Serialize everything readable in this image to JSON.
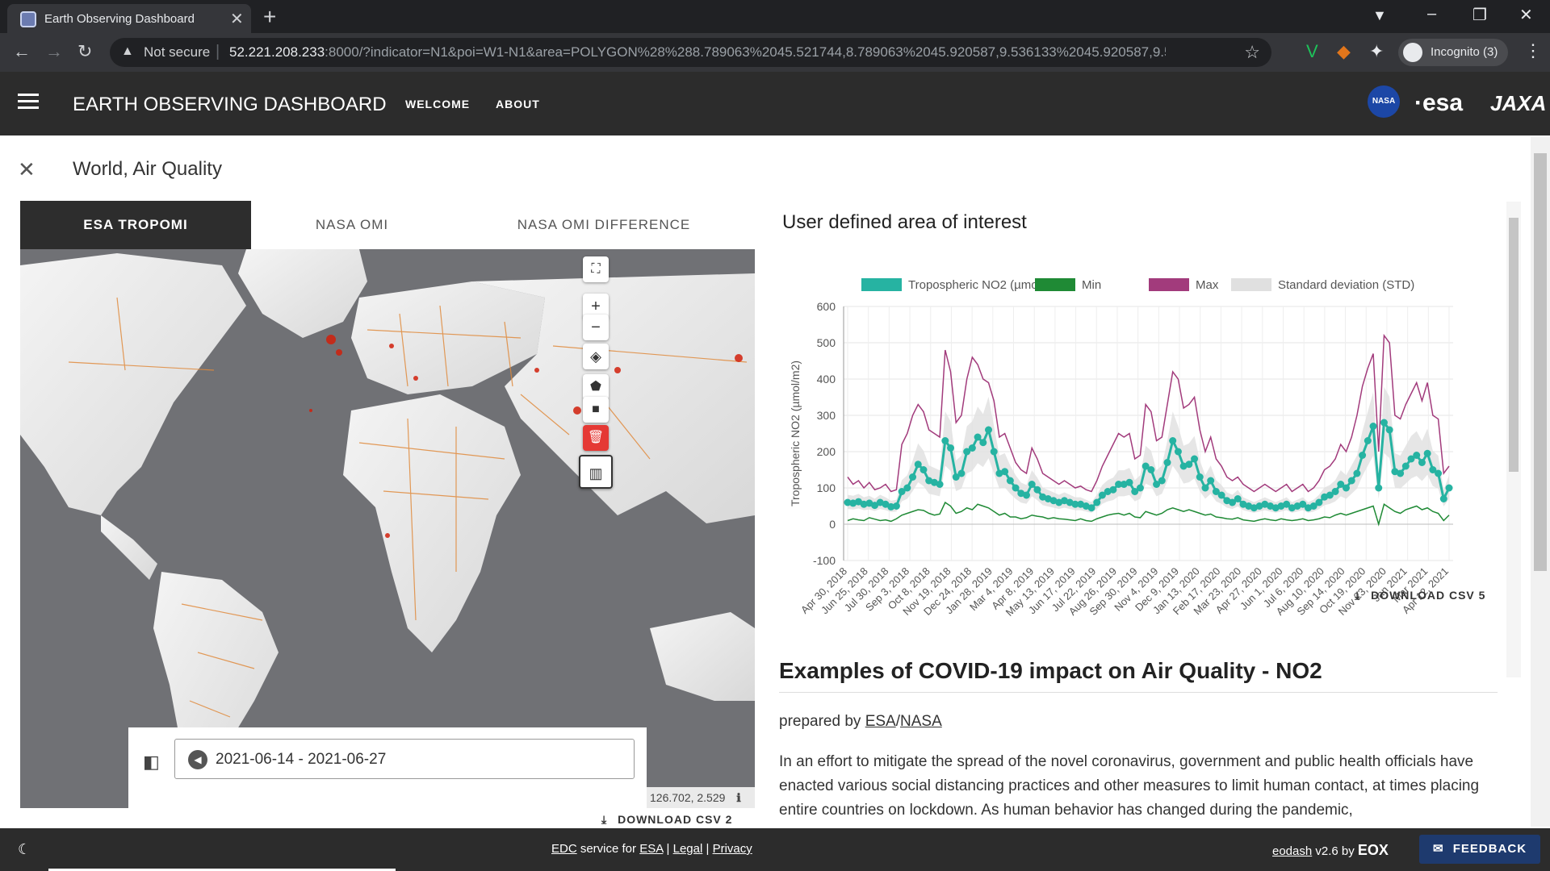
{
  "browser": {
    "tab_title": "Earth Observing Dashboard",
    "not_secure": "Not secure",
    "url_host": "52.221.208.233",
    "url_rest": ":8000/?indicator=N1&poi=W1-N1&area=POLYGON%28%288.789063%2045.521744,8.789063%2045.920587,9.536133%2045.920587,9.536133%204...",
    "incognito": "Incognito (3)"
  },
  "header": {
    "title": "EARTH OBSERVING DASHBOARD",
    "nav": [
      "WELCOME",
      "ABOUT"
    ],
    "logos": {
      "nasa": "NASA",
      "esa": "esa",
      "jaxa": "JAXA"
    }
  },
  "panel": {
    "title": "World, Air Quality",
    "tabs": [
      "ESA TROPOMI",
      "NASA OMI",
      "NASA OMI DIFFERENCE"
    ],
    "active_tab": "ESA TROPOMI"
  },
  "map": {
    "date_range": "2021-06-14 - 2021-06-27",
    "coords": "126.702, 2.529",
    "download": "DOWNLOAD CSV 2",
    "icons": [
      "fullscreen-icon",
      "zoom-in-icon",
      "zoom-out-icon",
      "layers-icon",
      "draw-polygon-icon",
      "draw-rectangle-icon",
      "delete-icon",
      "chart-icon",
      "compare-icon",
      "arrow-left-icon",
      "info-icon",
      "download-icon"
    ]
  },
  "aoi": {
    "title": "User defined area of interest",
    "download": "DOWNLOAD CSV 5"
  },
  "chart_data": {
    "type": "line",
    "ylabel": "Tropospheric NO2 (µmol/m2)",
    "ylim": [
      -100,
      600
    ],
    "yticks": [
      -100,
      0,
      100,
      200,
      300,
      400,
      500,
      600
    ],
    "xticks": [
      "Apr 30, 2018",
      "Jun 25, 2018",
      "Jul 30, 2018",
      "Sep 3, 2018",
      "Oct 8, 2018",
      "Nov 19, 2018",
      "Dec 24, 2018",
      "Jan 28, 2019",
      "Mar 4, 2019",
      "Apr 8, 2019",
      "May 13, 2019",
      "Jun 17, 2019",
      "Jul 22, 2019",
      "Aug 26, 2019",
      "Sep 30, 2019",
      "Nov 4, 2019",
      "Dec 9, 2019",
      "Jan 13, 2020",
      "Feb 17, 2020",
      "Mar 23, 2020",
      "Apr 27, 2020",
      "Jun 1, 2020",
      "Jul 6, 2020",
      "Aug 10, 2020",
      "Sep 14, 2020",
      "Oct 19, 2020",
      "Nov 23, 2020",
      "Jan 2021",
      "Mar 2021",
      "Apr 12, 2021"
    ],
    "legend_placement": "top",
    "grid": true,
    "legend": [
      {
        "name": "Tropospheric NO2 (µmol/m2)",
        "color": "#26b3a2"
      },
      {
        "name": "Min",
        "color": "#1f8a35"
      },
      {
        "name": "Max",
        "color": "#a23b7c"
      },
      {
        "name": "Standard deviation (STD)",
        "color": "#e0e0e0"
      }
    ],
    "series": [
      {
        "name": "Tropospheric NO2 (µmol/m2)",
        "values": [
          60,
          58,
          62,
          55,
          58,
          52,
          60,
          55,
          48,
          50,
          90,
          100,
          130,
          165,
          150,
          120,
          115,
          110,
          230,
          210,
          130,
          140,
          200,
          210,
          240,
          225,
          260,
          200,
          140,
          145,
          120,
          100,
          85,
          80,
          110,
          95,
          75,
          70,
          65,
          60,
          65,
          60,
          55,
          55,
          50,
          45,
          60,
          80,
          90,
          95,
          110,
          110,
          115,
          90,
          100,
          160,
          150,
          110,
          120,
          170,
          230,
          200,
          160,
          165,
          180,
          130,
          100,
          120,
          90,
          80,
          65,
          60,
          70,
          55,
          50,
          45,
          50,
          55,
          50,
          45,
          50,
          55,
          45,
          50,
          55,
          45,
          50,
          60,
          75,
          80,
          90,
          110,
          100,
          120,
          140,
          190,
          230,
          270,
          100,
          280,
          260,
          145,
          140,
          160,
          180,
          190,
          170,
          195,
          150,
          140,
          70,
          100
        ]
      },
      {
        "name": "Min",
        "values": [
          10,
          15,
          12,
          10,
          18,
          14,
          10,
          12,
          8,
          15,
          25,
          30,
          35,
          40,
          38,
          30,
          25,
          28,
          60,
          50,
          30,
          35,
          45,
          40,
          55,
          50,
          45,
          35,
          25,
          30,
          20,
          20,
          15,
          18,
          25,
          22,
          20,
          15,
          18,
          15,
          14,
          12,
          10,
          15,
          10,
          8,
          15,
          20,
          25,
          28,
          30,
          25,
          30,
          20,
          18,
          35,
          30,
          25,
          30,
          40,
          45,
          40,
          35,
          40,
          35,
          30,
          25,
          28,
          20,
          18,
          15,
          14,
          18,
          12,
          10,
          8,
          12,
          15,
          12,
          10,
          15,
          12,
          10,
          12,
          15,
          10,
          12,
          15,
          20,
          18,
          25,
          30,
          25,
          30,
          35,
          40,
          45,
          50,
          0,
          55,
          45,
          35,
          30,
          40,
          45,
          50,
          40,
          45,
          35,
          30,
          10,
          25
        ]
      },
      {
        "name": "Max",
        "values": [
          130,
          110,
          120,
          100,
          115,
          95,
          100,
          110,
          90,
          95,
          220,
          250,
          300,
          330,
          310,
          260,
          250,
          240,
          480,
          420,
          280,
          300,
          400,
          460,
          440,
          400,
          390,
          340,
          240,
          250,
          210,
          170,
          150,
          140,
          210,
          180,
          140,
          130,
          120,
          110,
          120,
          110,
          100,
          105,
          95,
          90,
          120,
          160,
          190,
          220,
          250,
          240,
          250,
          180,
          190,
          330,
          310,
          230,
          240,
          330,
          420,
          400,
          320,
          330,
          350,
          260,
          200,
          240,
          180,
          160,
          130,
          120,
          130,
          110,
          100,
          90,
          100,
          110,
          100,
          90,
          100,
          110,
          90,
          100,
          110,
          90,
          100,
          120,
          150,
          160,
          180,
          220,
          200,
          240,
          300,
          380,
          430,
          470,
          200,
          520,
          500,
          300,
          290,
          330,
          360,
          390,
          340,
          390,
          300,
          290,
          140,
          160
        ]
      }
    ]
  },
  "article": {
    "heading": "Examples of COVID-19 impact on Air Quality - NO2",
    "prepared_prefix": "prepared by ",
    "esa": "ESA",
    "slash": "/",
    "nasa": "NASA",
    "body": "In an effort to mitigate the spread of the novel coronavirus, government and public health officials have enacted various social distancing practices and other measures to limit human contact, at times placing entire countries on lockdown. As human behavior has changed during the pandemic,"
  },
  "footer": {
    "edc": "EDC",
    "service_for": " service for ",
    "esa": "ESA",
    "pipe1": " | ",
    "legal": "Legal",
    "pipe2": " | ",
    "privacy": "Privacy",
    "eodash": "eodash",
    "version": " v2.6 by ",
    "eox": "EOX",
    "feedback": "FEEDBACK"
  }
}
